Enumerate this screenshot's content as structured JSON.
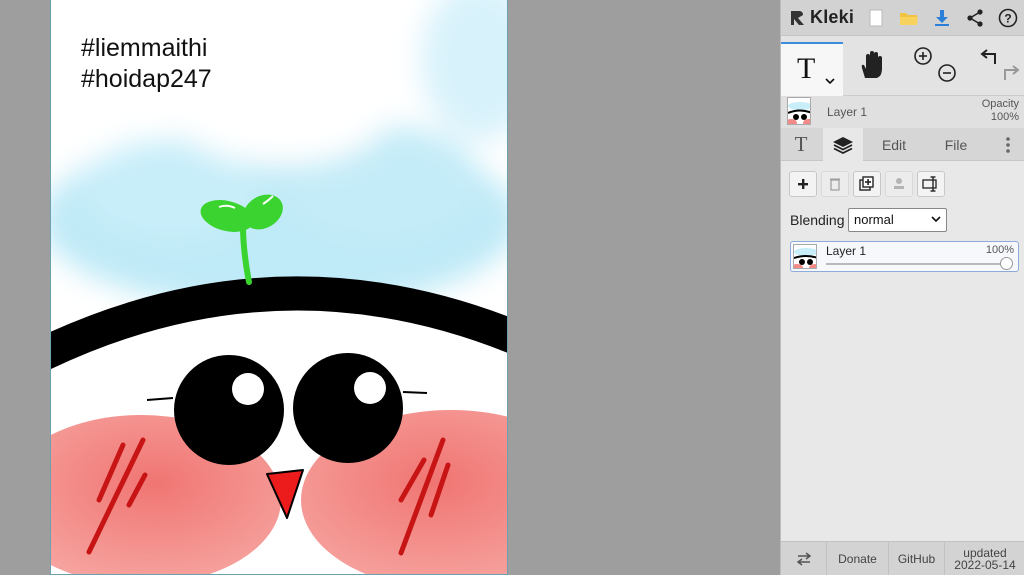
{
  "canvas": {
    "text_line1": "#liemmaithi",
    "text_line2": "#hoidap247"
  },
  "app": {
    "name": "Kleki",
    "icons": [
      "kleki-logo-icon",
      "new-file-icon",
      "open-folder-icon",
      "download-icon",
      "share-icon",
      "help-icon"
    ]
  },
  "toolbar": {
    "tool_letter": "T",
    "icons": [
      "text-tool-icon",
      "hand-tool-icon",
      "zoom-in-icon",
      "zoom-out-icon",
      "undo-icon",
      "redo-icon"
    ]
  },
  "layer_info": {
    "name": "Layer 1",
    "opacity_label": "Opacity",
    "opacity_value": "100%"
  },
  "tabs": [
    {
      "label": "T",
      "icon": "text-tab-icon",
      "active": false
    },
    {
      "label": "",
      "icon": "layers-icon",
      "active": true
    },
    {
      "label": "Edit",
      "active": false
    },
    {
      "label": "File",
      "active": false
    },
    {
      "label": "",
      "icon": "more-vertical-icon",
      "active": false
    }
  ],
  "layers_panel": {
    "buttons": [
      "add-layer-icon",
      "delete-layer-icon",
      "duplicate-layer-icon",
      "merge-down-icon",
      "rename-layer-icon"
    ],
    "blending_label": "Blending",
    "blending_value": "normal",
    "layers": [
      {
        "name": "Layer 1",
        "opacity": "100%",
        "opacity_fraction": 1.0
      }
    ]
  },
  "footer": {
    "swap_icon": "swap-arrows-icon",
    "donate": "Donate",
    "github": "GitHub",
    "updated_label": "updated",
    "updated_date": "2022-05-14"
  },
  "colors": {
    "accent": "#3d8bdb",
    "panel_bg": "#e8e8e8",
    "workspace_bg": "#9e9e9e",
    "sprout_green": "#3ad32f",
    "cheek_pink": "#f28a87"
  }
}
